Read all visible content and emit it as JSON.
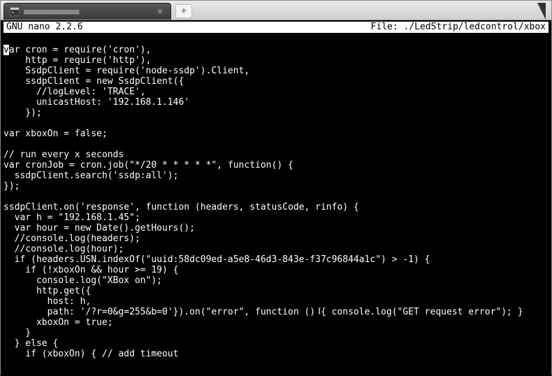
{
  "tab": {
    "title": "■■■■■■■■■■■■"
  },
  "statusbar": {
    "left": "  GNU nano 2.2.6",
    "right": "File: ./LedStrip/ledcontrol/xbox"
  },
  "code": {
    "lines": [
      "",
      "var cron = require('cron'),",
      "    http = require('http'),",
      "    SsdpClient = require('node-ssdp').Client,",
      "    ssdpClient = new SsdpClient({",
      "      //logLevel: 'TRACE',",
      "      unicastHost: '192.168.1.146'",
      "    });",
      "",
      "var xboxOn = false;",
      "",
      "// run every x seconds",
      "var cronJob = cron.job(\"*/20 * * * * *\", function() {",
      "  ssdpClient.search('ssdp:all');",
      "});",
      "",
      "ssdpClient.on('response', function (headers, statusCode, rinfo) {",
      "  var h = \"192.168.1.45\";",
      "  var hour = new Date().getHours();",
      "  //console.log(headers);",
      "  //console.log(hour);",
      "  if (headers.USN.indexOf(\"uuid:58dc09ed-a5e8-46d3-843e-f37c96844a1c\") > -1) {",
      "    if (!xboxOn && hour >= 19) {",
      "      console.log(\"XBox on\");",
      "      http.get({",
      "        host: h,",
      "        path: '/?r=0&g=255&b=0'}).on(\"error\", function () { console.log(\"GET request error\"); }",
      "      xboxOn = true;",
      "    }",
      "  } else {",
      "    if (xboxOn) { // add timeout"
    ],
    "cursor_line": 1,
    "cursor_col": 0,
    "ibeam": {
      "line": 26,
      "col": 58
    }
  }
}
